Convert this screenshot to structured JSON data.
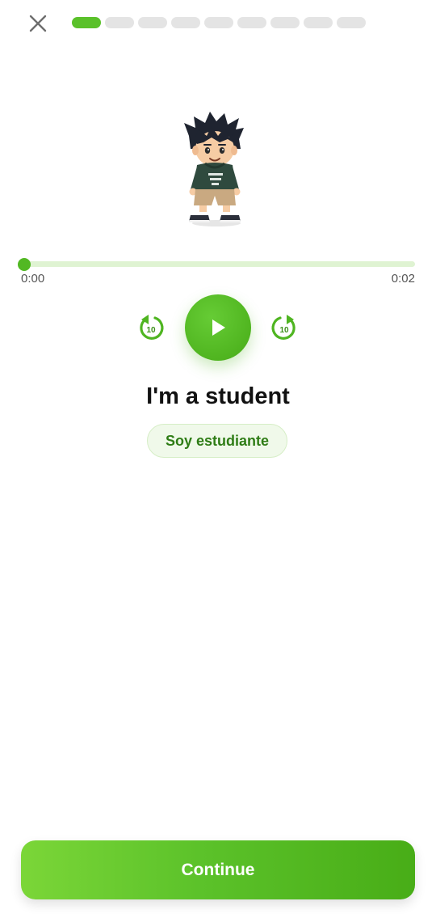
{
  "header": {
    "close_icon": "close-icon",
    "progress": {
      "total_steps": 9,
      "current_step": 1
    }
  },
  "lesson": {
    "character": "student-avatar",
    "audio": {
      "current_time": "0:00",
      "duration": "0:02",
      "progress": 0,
      "rewind_icon": "rewind-10-icon",
      "rewind_label": "10",
      "play_icon": "play-icon",
      "forward_icon": "forward-10-icon",
      "forward_label": "10"
    },
    "phrase": "I'm a student",
    "translation": "Soy estudiante"
  },
  "footer": {
    "continue_label": "Continue"
  },
  "colors": {
    "accent": "#5ac12a",
    "track": "#dff3d2",
    "translation_bg": "#f0f9ea",
    "translation_text": "#2f7d16"
  }
}
